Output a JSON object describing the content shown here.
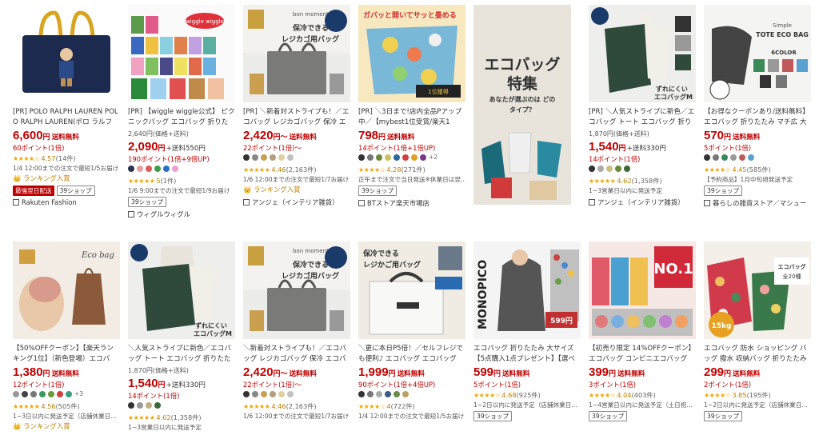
{
  "row1": [
    {
      "title": "[PR] POLO RALPH LAUREN POLO RALPH LAUREN(ポロ ラルフ ロ…",
      "price": "6,600",
      "yen": "円",
      "ship": "送料無料",
      "was": "",
      "points": "60ポイント(1倍)",
      "colors": [],
      "stars": "★★★★☆",
      "rating": "4.57",
      "rcount": "(14件)",
      "note": "1/4 12:00までの注文で最短1/5お届け",
      "rank": "ランキング入賞",
      "badges_red": [
        "最強翌日配送"
      ],
      "badges_box": [
        "39ショップ"
      ],
      "shop": "Rakuten Fashion"
    },
    {
      "title": "[PR] 【wiggle wiggle公式】 ピクニックバッグ エコバッグ 折りたた…",
      "price": "2,090",
      "yen": "円",
      "ship": "",
      "shipnote": "+送料550円",
      "was": "2,640円(価格+送料)",
      "points": "190ポイント(1倍+9倍UP)",
      "colors": [
        "#2a3050",
        "#e8a0a0",
        "#e05a5a",
        "#3aa04a",
        "#2a70c8",
        "#f0a0d0"
      ],
      "stars": "★★★★★",
      "rating": "5",
      "rcount": "(1件)",
      "note": "1/6 9:00までの注文で最短1/9お届け",
      "rank": "",
      "badges_red": [],
      "badges_box": [
        "39ショップ"
      ],
      "shop": "ウィグルウィグル"
    },
    {
      "title": "[PR] ＼新着対ストライプも！／エコバッグ レジカゴバッグ 保冷 エコ…",
      "price": "2,420",
      "yen": "円～",
      "ship": "送料無料",
      "was": "",
      "points": "22ポイント(1倍)～",
      "colors": [
        "#333",
        "#888",
        "#caa050",
        "#b0a080",
        "#e0d0a0",
        "#c0c0c0"
      ],
      "stars": "★★★★★",
      "rating": "4.46",
      "rcount": "(2,163件)",
      "note": "1/6 12:00までの注文で最短1/7お届け",
      "rank": "ランキング入賞",
      "badges_red": [],
      "badges_box": [],
      "shop": "アンジェ（インテリア雑貨）"
    },
    {
      "title": "[PR] ＼3日まで!店内全品Pアップ中／【mybest1位受賞/楽天1位】…",
      "price": "798",
      "yen": "円",
      "ship": "送料無料",
      "was": "",
      "points": "14ポイント(1倍+1倍UP)",
      "colors": [
        "#333",
        "#777",
        "#6a8a3a",
        "#d0c060",
        "#2a6aa0",
        "#d04040",
        "#e0a020",
        "#7a3a8a"
      ],
      "more": "+2",
      "stars": "★★★★☆",
      "rating": "4.28",
      "rcount": "(271件)",
      "note": "正午まで注文で当日発送※休業日は翌…",
      "rank": "",
      "badges_red": [],
      "badges_box": [
        "39ショップ"
      ],
      "shop": "BTストア楽天市場店"
    },
    {
      "title": "",
      "price": "",
      "yen": "",
      "ship": "",
      "was": "",
      "points": "",
      "colors": [],
      "stars": "",
      "rating": "",
      "rcount": "",
      "note": "",
      "rank": "",
      "badges_red": [],
      "badges_box": [],
      "shop": "",
      "ad_title": "エコバッグ",
      "ad_sub": "特集",
      "ad_q": "あなたが選ぶのは どのタイプ？"
    },
    {
      "title": "[PR] ＼人気ストライプに新色／エコバッグ トート エコバッグ 折りたた…",
      "price": "1,540",
      "yen": "円",
      "ship": "",
      "shipnote": "+送料330円",
      "was": "1,870円(価格+送料)",
      "points": "14ポイント(1倍)",
      "colors": [
        "#333",
        "#aaa",
        "#d0c080",
        "#6a8a3a",
        "#3a6a3a"
      ],
      "stars": "★★★★★",
      "rating": "4.62",
      "rcount": "(1,358件)",
      "note": "1~3営業日以内に発送予定",
      "rank": "",
      "badges_red": [],
      "badges_box": [],
      "shop": "アンジェ（インテリア雑貨）"
    },
    {
      "title": "【お得なクーポンあり/送料無料】 エコバッグ 折りたたみ マチ広 大容…",
      "price": "570",
      "yen": "円",
      "ship": "送料無料",
      "was": "",
      "points": "5ポイント(1倍)",
      "colors": [
        "#333",
        "#777",
        "#3a8a5a",
        "#9a9a9a",
        "#c05a5a",
        "#5aa0d0"
      ],
      "stars": "★★★★☆",
      "rating": "4.45",
      "rcount": "(585件)",
      "note": "【予約商品】1月中旬頃発送予定",
      "rank": "",
      "badges_red": [],
      "badges_box": [
        "39ショップ"
      ],
      "shop": "暮らしの雑貨ストア／マシュー"
    }
  ],
  "row2": [
    {
      "title": "【50%OFFクーポン】【楽天ランキング1位】（新色登場）エコバッ…",
      "price": "1,380",
      "yen": "円",
      "ship": "送料無料",
      "was": "",
      "points": "12ポイント(1倍)",
      "colors": [
        "#999",
        "#444",
        "#777",
        "#3a9a5a",
        "#6a9a3a",
        "#d04040",
        "#3aa07a"
      ],
      "more": "+3",
      "stars": "★★★★★",
      "rating": "4.56",
      "rcount": "(505件)",
      "note": "1~3日以内に発送予定（店舗休業日…",
      "rank": "ランキング入賞",
      "badges_red": [],
      "badges_box": [],
      "shop": ""
    },
    {
      "title": "＼人気ストライプに新色／エコバッグ トート エコバッグ 折りたたみ…",
      "price": "1,540",
      "yen": "円",
      "ship": "",
      "shipnote": "+送料330円",
      "was": "1,870円(価格+送料)",
      "points": "14ポイント(1倍)",
      "colors": [
        "#333",
        "#999",
        "#c0b080",
        "#3a6a3a"
      ],
      "stars": "★★★★★",
      "rating": "4.62",
      "rcount": "(1,358件)",
      "note": "1~3営業日以内に発送予定",
      "rank": "",
      "badges_red": [],
      "badges_box": [],
      "shop": ""
    },
    {
      "title": "＼新着対ストライプも！／エコバッグ レジカゴバッグ 保冷 エコバッ…",
      "price": "2,420",
      "yen": "円～",
      "ship": "送料無料",
      "was": "",
      "points": "22ポイント(1倍)～",
      "colors": [
        "#333",
        "#888",
        "#caa050",
        "#b0a080",
        "#e0d0a0",
        "#c0c0c0"
      ],
      "stars": "★★★★★",
      "rating": "4.46",
      "rcount": "(2,163件)",
      "note": "1/6 12:00までの注文で最短1/7お届け",
      "rank": "",
      "badges_red": [],
      "badges_box": [],
      "shop": ""
    },
    {
      "title": "＼更に本日P5倍！／セルフレジでも便利♪ エコバッグ エコバッグ 折…",
      "price": "1,999",
      "yen": "円",
      "ship": "送料無料",
      "was": "",
      "points": "90ポイント(1倍+4倍UP)",
      "colors": [
        "#333",
        "#777",
        "#aaa",
        "#3a5a8a",
        "#6a8a4a",
        "#c0a060"
      ],
      "stars": "★★★★☆",
      "rating": "4",
      "rcount": "(722件)",
      "note": "1/4 12:00までの注文で最短1/5お届け",
      "rank": "",
      "badges_red": [],
      "badges_box": [],
      "shop": ""
    },
    {
      "title": "エコバッグ 折りたたみ 大サイズ【5点購入1点プレゼント】【選べる1…",
      "price": "599",
      "yen": "円",
      "ship": "送料無料",
      "was": "",
      "points": "5ポイント(1倍)",
      "colors": [],
      "stars": "★★★★☆",
      "rating": "4.68",
      "rcount": "(925件)",
      "note": "1~2日以内に発送予定（店舗休業日…",
      "rank": "",
      "badges_red": [],
      "badges_box": [
        "39ショップ"
      ],
      "shop": ""
    },
    {
      "title": "【初売り限定 14%OFFクーポン】エコバッグ コンビニエコバッグ コ…",
      "price": "399",
      "yen": "円",
      "ship": "送料無料",
      "was": "",
      "points": "3ポイント(1倍)",
      "colors": [],
      "stars": "★★★★☆",
      "rating": "4.04",
      "rcount": "(403件)",
      "note": "1~4営業日以内に発送予定（土日祝…",
      "rank": "",
      "badges_red": [],
      "badges_box": [
        "39ショップ"
      ],
      "shop": ""
    },
    {
      "title": "エコバッグ 防水 ショッピング バッグ 撥水 収納バッグ 折りたたみ パ…",
      "price": "299",
      "yen": "円",
      "ship": "送料無料",
      "was": "",
      "points": "2ポイント(1倍)",
      "colors": [],
      "stars": "★★★★☆",
      "rating": "3.85",
      "rcount": "(195件)",
      "note": "1~2日以内に発送予定（店舗休業日…",
      "rank": "",
      "badges_red": [],
      "badges_box": [
        "39ショップ"
      ],
      "shop": ""
    }
  ],
  "thumb_text": {
    "r1c3_a": "bon moment",
    "r1c3_b": "保冷できる レジカゴ用バッグ",
    "r1c4_a": "ガバッと開いてサッと畳める",
    "r1c7_a": "Simple TOTE ECO BAG",
    "r1c7_b": "6COLOR",
    "r2c1_a": "Eco bag",
    "r2c2_a": "ずれにくい エコバッグM",
    "r2c4_a": "保冷できる レジかご用バッグ",
    "r2c5_a": "MONOPICO",
    "r2c5_b": "599円",
    "r2c6_a": "エコバッグ NO.1",
    "r2c7_a": "エコバッグ 全20種",
    "r2c7_b": "15kg"
  }
}
